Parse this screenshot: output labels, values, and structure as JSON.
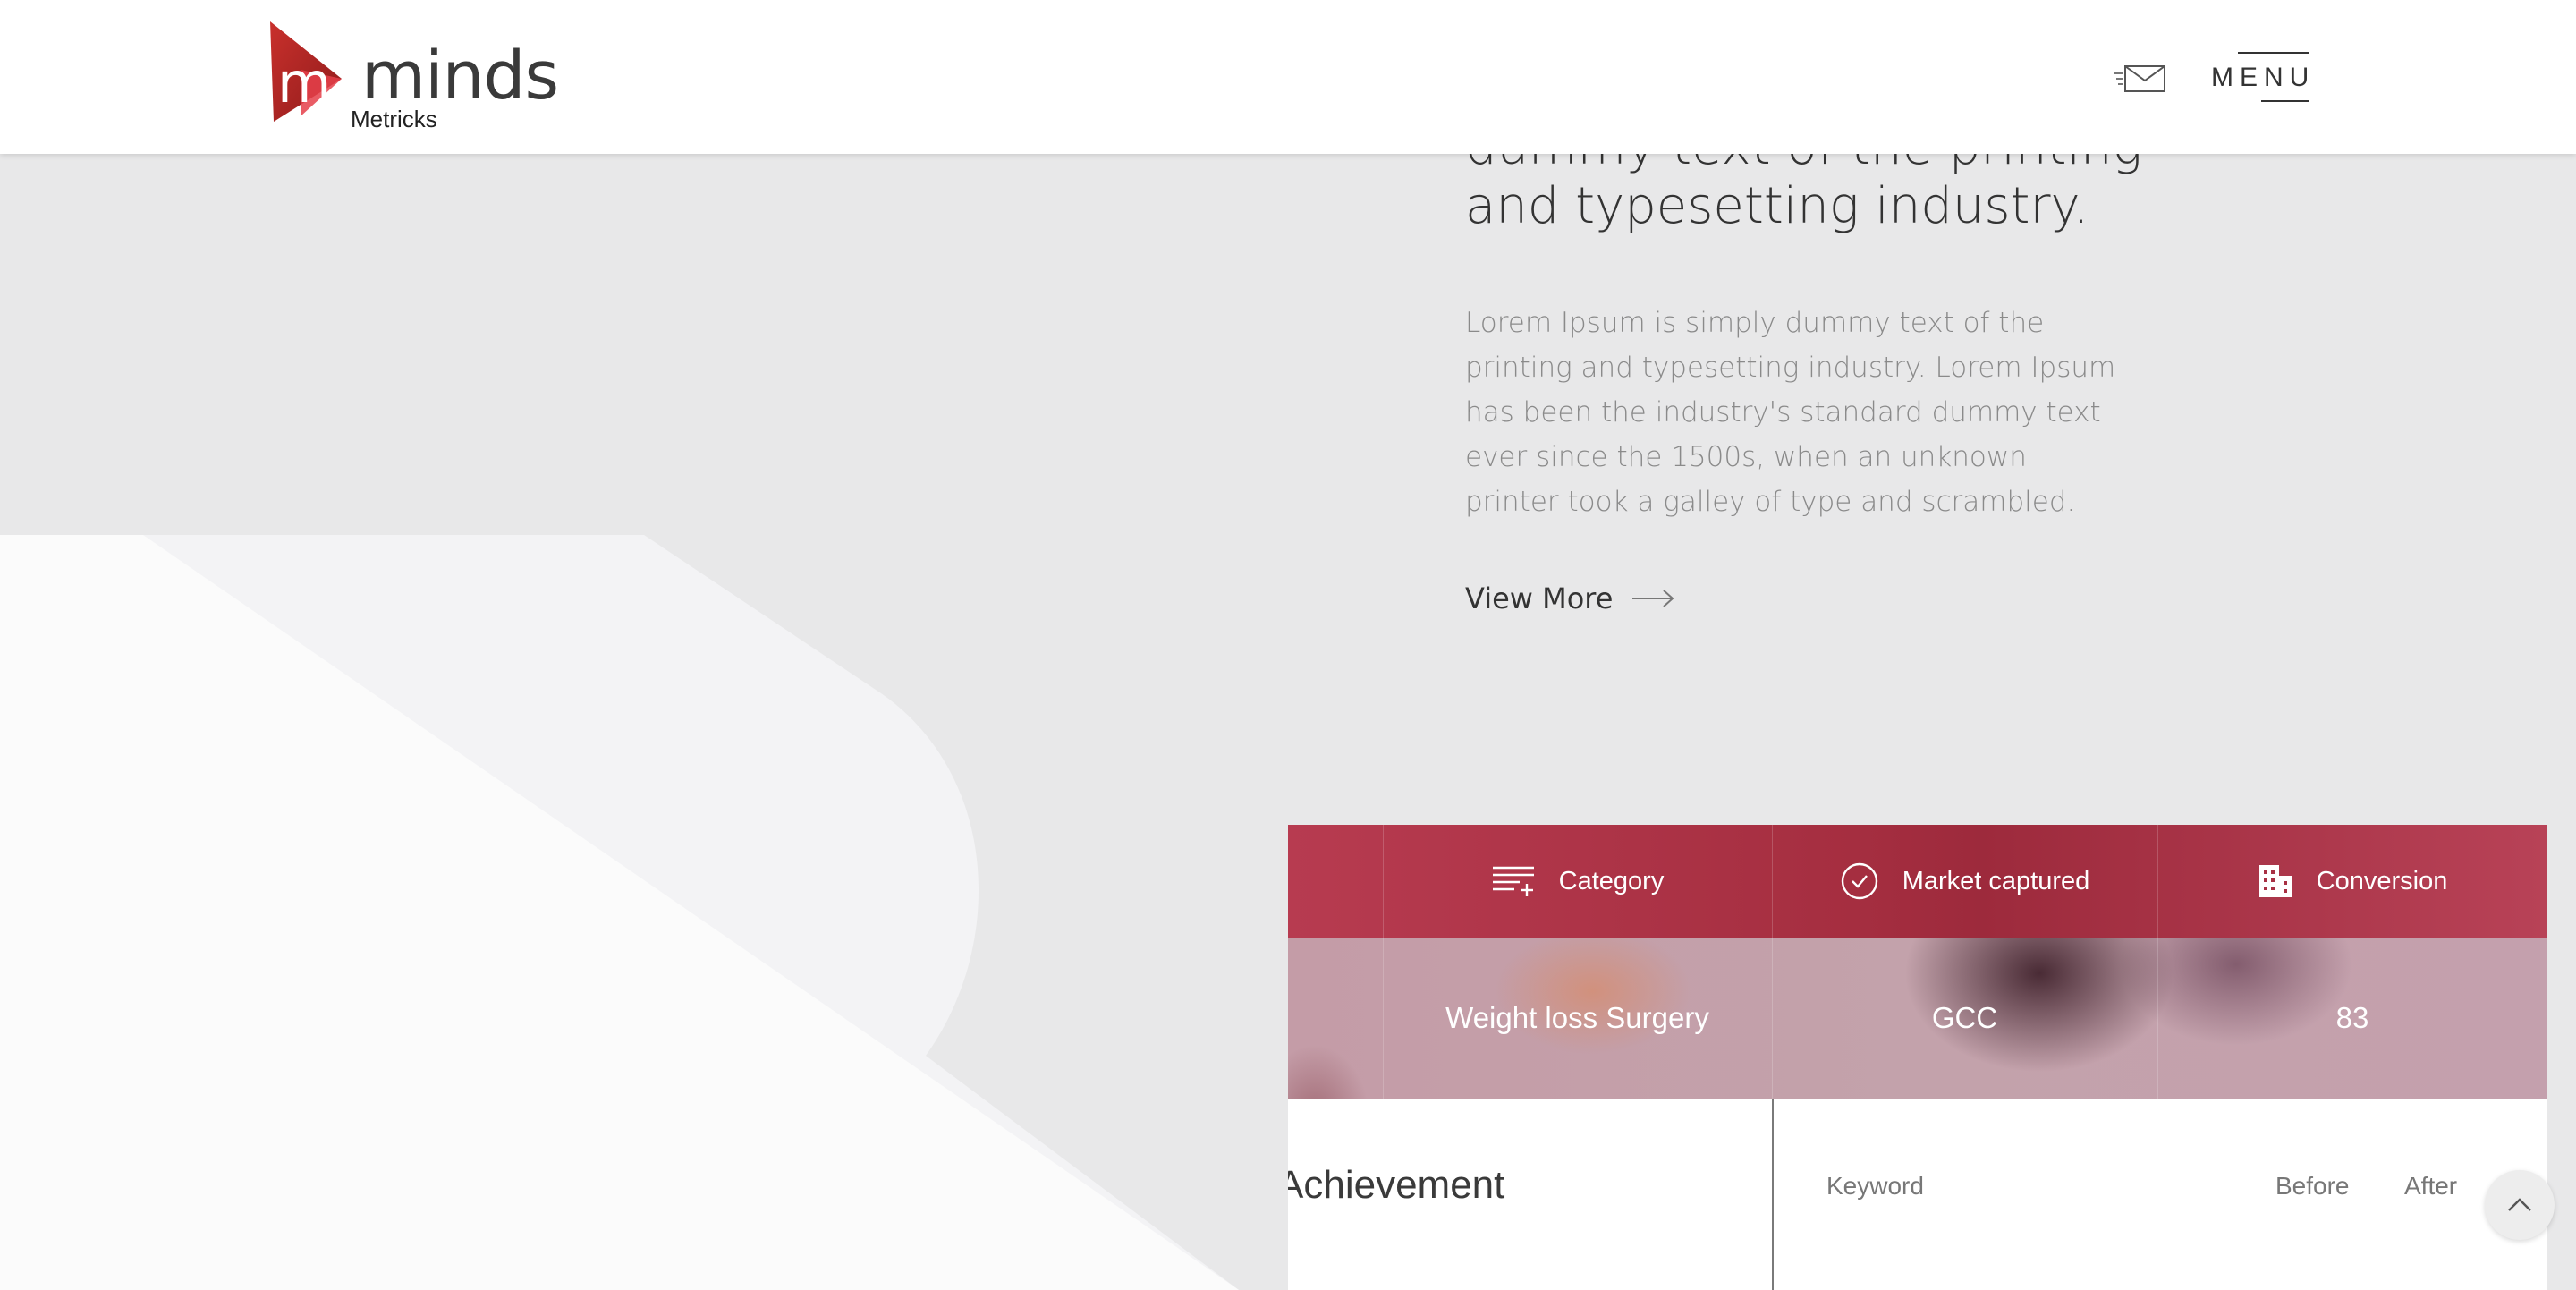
{
  "header": {
    "logo_word": "minds",
    "logo_sub": "Metricks",
    "menu_label": "MENU",
    "icons": {
      "mail": "mail-icon"
    }
  },
  "content": {
    "heading_line1": "dummy text of the printing",
    "heading_line2": "and typesetting industry.",
    "paragraph": "Lorem Ipsum is simply dummy text of the printing and typesetting industry. Lorem Ipsum has been the industry's standard dummy text ever since the 1500s, when an unknown printer took a galley of type and scrambled.",
    "view_more": "View More"
  },
  "table": {
    "headers": [
      {
        "label": "Category",
        "icon": "add-list-icon"
      },
      {
        "label": "Market captured",
        "icon": "check-circle-icon"
      },
      {
        "label": "Conversion",
        "icon": "building-icon"
      }
    ],
    "row": [
      "Weight loss Surgery",
      "GCC",
      "83"
    ]
  },
  "lower": {
    "title": "Achievement",
    "columns": [
      "Keyword",
      "Before",
      "After"
    ]
  },
  "colors": {
    "brand_red": "#c0392b",
    "panel_header": "#a83043",
    "text_dark": "#333333",
    "text_muted": "#8a8a8a"
  }
}
